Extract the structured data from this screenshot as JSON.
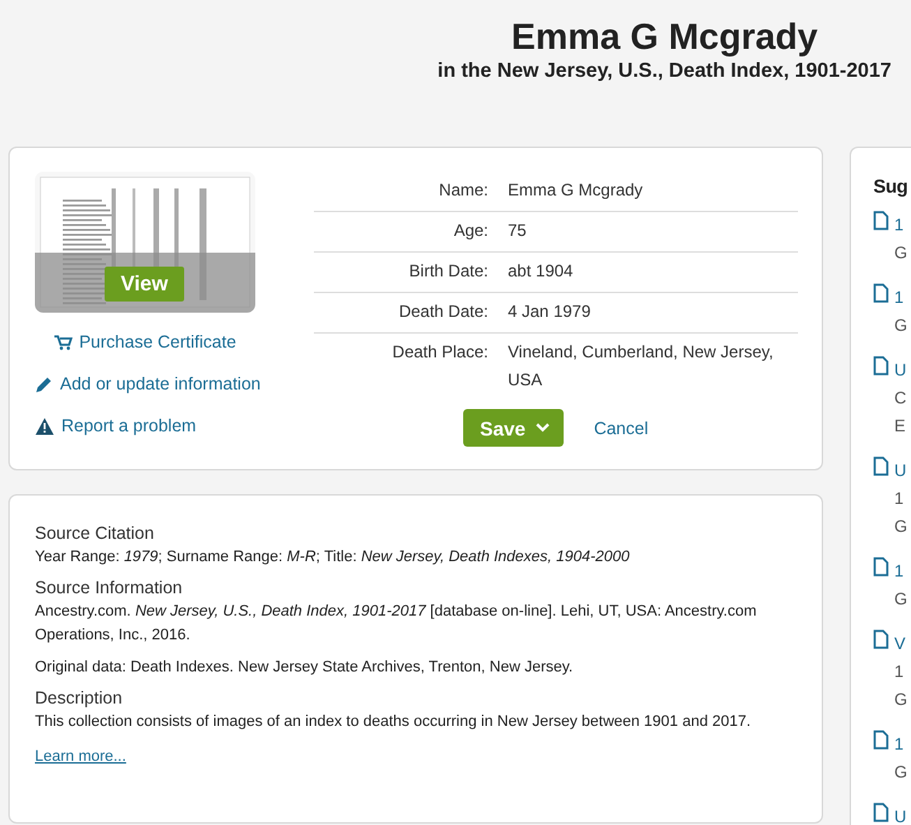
{
  "header": {
    "title": "Emma G Mcgrady",
    "subtitle": "in the New Jersey, U.S., Death Index, 1901-2017"
  },
  "record": {
    "image": {
      "kind": "picture",
      "button": "View"
    },
    "links": [
      {
        "kind": "cart",
        "label": "Purchase Certificate"
      },
      {
        "kind": "pencil",
        "label": "Add or update information"
      },
      {
        "kind": "warning",
        "label": "Report a problem"
      }
    ],
    "fields": [
      {
        "label": "Name:",
        "value": "Emma G Mcgrady"
      },
      {
        "label": "Age:",
        "value": "75"
      },
      {
        "label": "Birth Date:",
        "value": "abt 1904"
      },
      {
        "label": "Death Date:",
        "value": "4 Jan 1979"
      },
      {
        "label": "Death Place:",
        "value": "Vineland, Cumberland, New Jersey, USA"
      }
    ],
    "save": "Save",
    "cancel": "Cancel"
  },
  "source": {
    "sections": [
      {
        "heading": "Source Citation",
        "paragraphs": [
          "Year Range: *1979*; Surname Range: *M-R*; Title: *New Jersey, Death Indexes, 1904-2000*"
        ]
      },
      {
        "heading": "Source Information",
        "paragraphs": [
          "Ancestry.com. *New Jersey, U.S., Death Index, 1901-2017* [database on-line]. Lehi, UT, USA: Ancestry.com Operations, Inc., 2016.",
          "Original data: Death Indexes. New Jersey State Archives, Trenton, New Jersey."
        ]
      },
      {
        "heading": "Description",
        "paragraphs": [
          "This collection consists of images of an index to deaths occurring in New Jersey between 1901 and 2017."
        ],
        "link": "Learn more..."
      }
    ]
  },
  "suggested": {
    "title": "Sug",
    "items": [
      {
        "lines": [
          "1",
          "G"
        ]
      },
      {
        "lines": [
          "1",
          "G"
        ]
      },
      {
        "lines": [
          "U",
          "C",
          "E"
        ]
      },
      {
        "lines": [
          "U",
          "1",
          "G"
        ]
      },
      {
        "lines": [
          "1",
          "G"
        ]
      },
      {
        "lines": [
          "V",
          "1",
          "G"
        ]
      },
      {
        "lines": [
          "1",
          "G"
        ]
      },
      {
        "lines": [
          "U"
        ]
      }
    ]
  }
}
